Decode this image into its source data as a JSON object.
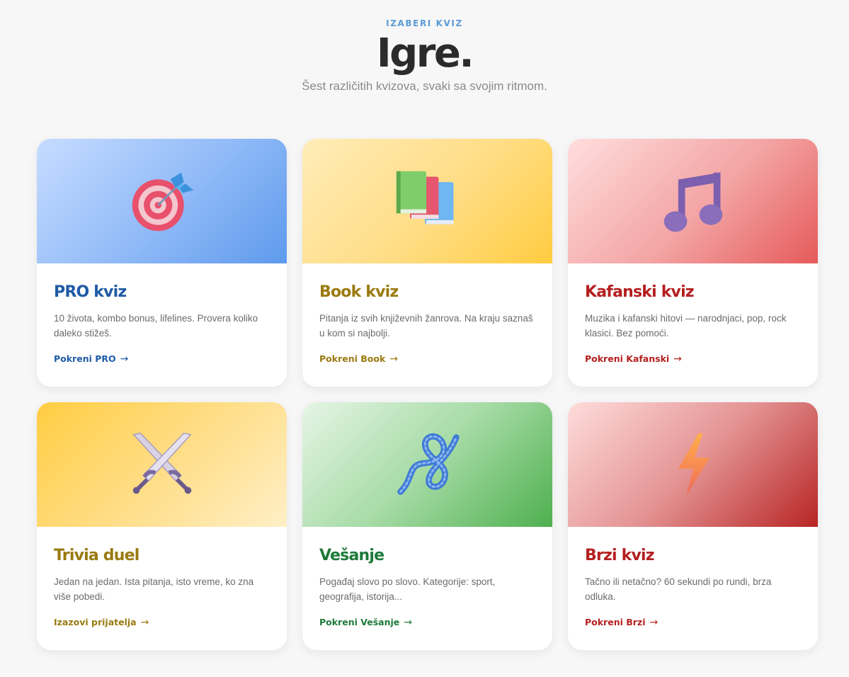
{
  "header": {
    "eyebrow": "IZABERI KVIZ",
    "title": "Igre.",
    "subtitle": "Šest različitih kvizova, svaki sa svojim ritmom."
  },
  "cards": [
    {
      "title": "PRO kviz",
      "description": "10 života, kombo bonus, lifelines. Provera koliko daleko stižeš.",
      "cta": "Pokreni PRO",
      "icon": "target-icon",
      "accent": "#1f5ba6"
    },
    {
      "title": "Book kviz",
      "description": "Pitanja iz svih književnih žanrova. Na kraju saznaš u kom si najbolji.",
      "cta": "Pokreni Book",
      "icon": "books-icon",
      "accent": "#9a7a10"
    },
    {
      "title": "Kafanski kviz",
      "description": "Muzika i kafanski hitovi — narodnjaci, pop, rock klasici. Bez pomoći.",
      "cta": "Pokreni Kafanski",
      "icon": "music-note-icon",
      "accent": "#b51f1f"
    },
    {
      "title": "Trivia duel",
      "description": "Jedan na jedan. Ista pitanja, isto vreme, ko zna više pobedi.",
      "cta": "Izazovi prijatelja",
      "icon": "crossed-swords-icon",
      "accent": "#9a7a10"
    },
    {
      "title": "Vešanje",
      "description": "Pogađaj slovo po slovo. Kategorije: sport, geografija, istorija...",
      "cta": "Pokreni Vešanje",
      "icon": "knot-icon",
      "accent": "#1d7a3a"
    },
    {
      "title": "Brzi kviz",
      "description": "Tačno ili netačno? 60 sekundi po rundi, brza odluka.",
      "cta": "Pokreni Brzi",
      "icon": "lightning-icon",
      "accent": "#b51f1f"
    }
  ],
  "cta_arrow": "→"
}
